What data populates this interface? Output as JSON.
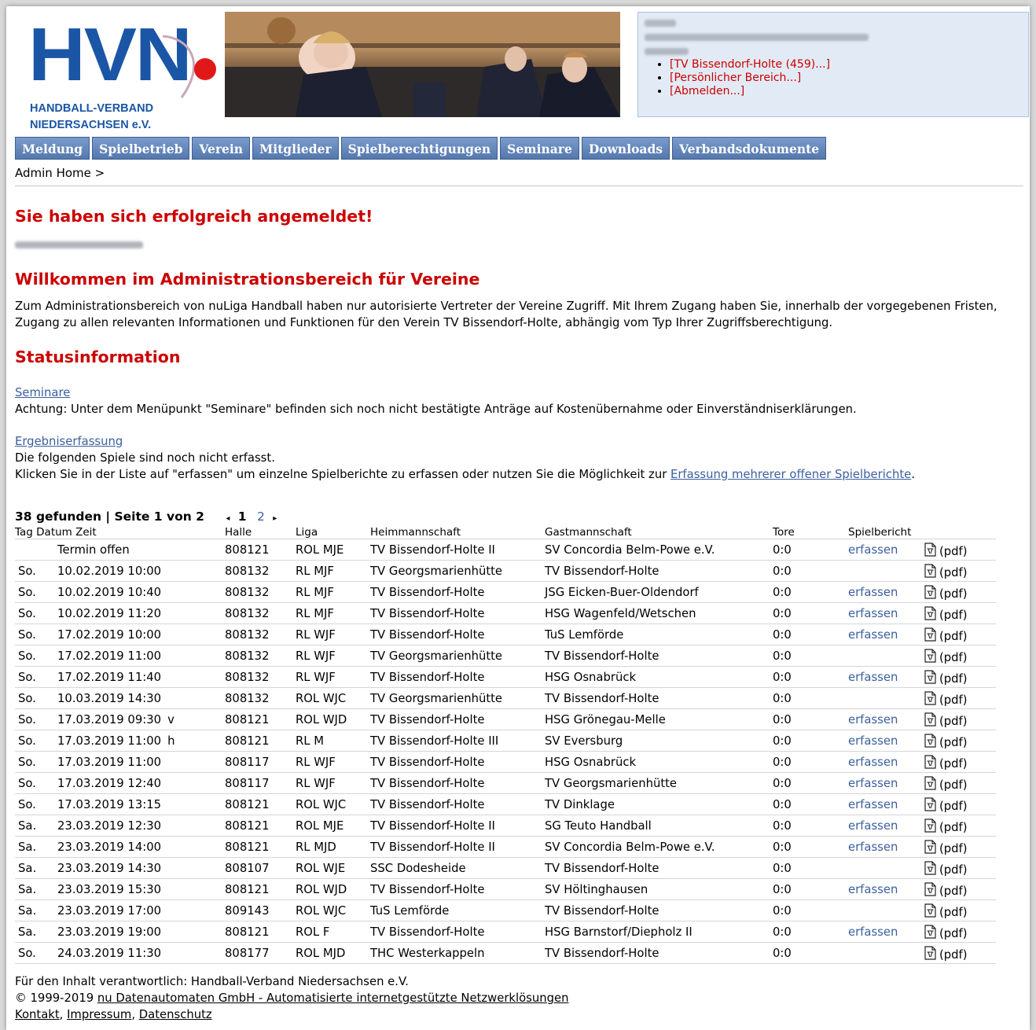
{
  "logo": {
    "letters": "HVN",
    "line1": "HANDBALL-VERBAND",
    "line2": "NIEDERSACHSEN e.V."
  },
  "userbox": {
    "links": [
      "[TV Bissendorf-Holte (459)...]",
      "[Persönlicher Bereich...]",
      "[Abmelden...]"
    ]
  },
  "nav": [
    "Meldung",
    "Spielbetrieb",
    "Verein",
    "Mitglieder",
    "Spielberechtigungen",
    "Seminare",
    "Downloads",
    "Verbandsdokumente"
  ],
  "breadcrumb": "Admin Home >",
  "login_title": "Sie haben sich erfolgreich angemeldet!",
  "welcome_title": "Willkommen im Administrationsbereich für Vereine",
  "intro_text": "Zum Administrationsbereich von nuLiga Handball haben nur autorisierte Vertreter der Vereine Zugriff. Mit Ihrem Zugang haben Sie, innerhalb der vorgegebenen Fristen, Zugang zu allen relevanten Informationen und Funktionen für den Verein TV Bissendorf-Holte, abhängig vom Typ Ihrer Zugriffsberechtigung.",
  "status_title": "Statusinformation",
  "seminare": {
    "link": "Seminare",
    "text": "Achtung: Unter dem Menüpunkt \"Seminare\" befinden sich noch nicht bestätigte Anträge auf Kostenübernahme oder Einverständniserklärungen."
  },
  "ergebnis": {
    "link": "Ergebniserfassung",
    "line1": "Die folgenden Spiele sind noch nicht erfasst.",
    "line2_pre": "Klicken Sie in der Liste auf \"erfassen\" um einzelne Spielberichte zu erfassen oder nutzen Sie die Möglichkeit zur ",
    "line2_link": "Erfassung mehrerer offener Spielberichte",
    "line2_post": "."
  },
  "pager": {
    "summary": "38 gefunden | Seite 1 von 2",
    "prev": "◂",
    "current": "1",
    "next_page": "2",
    "next": "▸"
  },
  "table": {
    "headers": {
      "tag_datum_zeit": "Tag Datum Zeit",
      "halle": "Halle",
      "liga": "Liga",
      "heim": "Heimmannschaft",
      "gast": "Gastmannschaft",
      "tore": "Tore",
      "bericht": "Spielbericht"
    },
    "erfassen_label": "erfassen",
    "pdf_label": "(pdf)",
    "rows": [
      {
        "tag": "",
        "datum": "Termin offen",
        "flag": "",
        "halle": "808121",
        "liga": "ROL MJE",
        "heim": "TV Bissendorf-Holte II",
        "gast": "SV Concordia Belm-Powe e.V.",
        "tore": "0:0",
        "erfassen": true
      },
      {
        "tag": "So.",
        "datum": "10.02.2019 10:00",
        "flag": "",
        "halle": "808132",
        "liga": "RL MJF",
        "heim": "TV Georgsmarienhütte",
        "gast": "TV Bissendorf-Holte",
        "tore": "0:0",
        "erfassen": false
      },
      {
        "tag": "So.",
        "datum": "10.02.2019 10:40",
        "flag": "",
        "halle": "808132",
        "liga": "RL MJF",
        "heim": "TV Bissendorf-Holte",
        "gast": "JSG Eicken-Buer-Oldendorf",
        "tore": "0:0",
        "erfassen": true
      },
      {
        "tag": "So.",
        "datum": "10.02.2019 11:20",
        "flag": "",
        "halle": "808132",
        "liga": "RL MJF",
        "heim": "TV Bissendorf-Holte",
        "gast": "HSG Wagenfeld/Wetschen",
        "tore": "0:0",
        "erfassen": true
      },
      {
        "tag": "So.",
        "datum": "17.02.2019 10:00",
        "flag": "",
        "halle": "808132",
        "liga": "RL WJF",
        "heim": "TV Bissendorf-Holte",
        "gast": "TuS Lemförde",
        "tore": "0:0",
        "erfassen": true
      },
      {
        "tag": "So.",
        "datum": "17.02.2019 11:00",
        "flag": "",
        "halle": "808132",
        "liga": "RL WJF",
        "heim": "TV Georgsmarienhütte",
        "gast": "TV Bissendorf-Holte",
        "tore": "0:0",
        "erfassen": false
      },
      {
        "tag": "So.",
        "datum": "17.02.2019 11:40",
        "flag": "",
        "halle": "808132",
        "liga": "RL WJF",
        "heim": "TV Bissendorf-Holte",
        "gast": "HSG Osnabrück",
        "tore": "0:0",
        "erfassen": true
      },
      {
        "tag": "So.",
        "datum": "10.03.2019 14:30",
        "flag": "",
        "halle": "808132",
        "liga": "ROL WJC",
        "heim": "TV Georgsmarienhütte",
        "gast": "TV Bissendorf-Holte",
        "tore": "0:0",
        "erfassen": false
      },
      {
        "tag": "So.",
        "datum": "17.03.2019 09:30",
        "flag": "v",
        "halle": "808121",
        "liga": "ROL WJD",
        "heim": "TV Bissendorf-Holte",
        "gast": "HSG Grönegau-Melle",
        "tore": "0:0",
        "erfassen": true
      },
      {
        "tag": "So.",
        "datum": "17.03.2019 11:00",
        "flag": "h",
        "halle": "808121",
        "liga": "RL M",
        "heim": "TV Bissendorf-Holte III",
        "gast": "SV Eversburg",
        "tore": "0:0",
        "erfassen": true
      },
      {
        "tag": "So.",
        "datum": "17.03.2019 11:00",
        "flag": "",
        "halle": "808117",
        "liga": "RL WJF",
        "heim": "TV Bissendorf-Holte",
        "gast": "HSG Osnabrück",
        "tore": "0:0",
        "erfassen": true
      },
      {
        "tag": "So.",
        "datum": "17.03.2019 12:40",
        "flag": "",
        "halle": "808117",
        "liga": "RL WJF",
        "heim": "TV Bissendorf-Holte",
        "gast": "TV Georgsmarienhütte",
        "tore": "0:0",
        "erfassen": true
      },
      {
        "tag": "So.",
        "datum": "17.03.2019 13:15",
        "flag": "",
        "halle": "808121",
        "liga": "ROL WJC",
        "heim": "TV Bissendorf-Holte",
        "gast": "TV Dinklage",
        "tore": "0:0",
        "erfassen": true
      },
      {
        "tag": "Sa.",
        "datum": "23.03.2019 12:30",
        "flag": "",
        "halle": "808121",
        "liga": "ROL MJE",
        "heim": "TV Bissendorf-Holte II",
        "gast": "SG Teuto Handball",
        "tore": "0:0",
        "erfassen": true
      },
      {
        "tag": "Sa.",
        "datum": "23.03.2019 14:00",
        "flag": "",
        "halle": "808121",
        "liga": "RL MJD",
        "heim": "TV Bissendorf-Holte II",
        "gast": "SV Concordia Belm-Powe e.V.",
        "tore": "0:0",
        "erfassen": true
      },
      {
        "tag": "Sa.",
        "datum": "23.03.2019 14:30",
        "flag": "",
        "halle": "808107",
        "liga": "ROL WJE",
        "heim": "SSC Dodesheide",
        "gast": "TV Bissendorf-Holte",
        "tore": "0:0",
        "erfassen": false
      },
      {
        "tag": "Sa.",
        "datum": "23.03.2019 15:30",
        "flag": "",
        "halle": "808121",
        "liga": "ROL WJD",
        "heim": "TV Bissendorf-Holte",
        "gast": "SV Höltinghausen",
        "tore": "0:0",
        "erfassen": true
      },
      {
        "tag": "Sa.",
        "datum": "23.03.2019 17:00",
        "flag": "",
        "halle": "809143",
        "liga": "ROL WJC",
        "heim": "TuS Lemförde",
        "gast": "TV Bissendorf-Holte",
        "tore": "0:0",
        "erfassen": false
      },
      {
        "tag": "Sa.",
        "datum": "23.03.2019 19:00",
        "flag": "",
        "halle": "808121",
        "liga": "ROL F",
        "heim": "TV Bissendorf-Holte",
        "gast": "HSG Barnstorf/Diepholz II",
        "tore": "0:0",
        "erfassen": true
      },
      {
        "tag": "So.",
        "datum": "24.03.2019 11:30",
        "flag": "",
        "halle": "808177",
        "liga": "ROL MJD",
        "heim": "THC Westerkappeln",
        "gast": "TV Bissendorf-Holte",
        "tore": "0:0",
        "erfassen": false
      }
    ]
  },
  "footer": {
    "line1": "Für den Inhalt verantwortlich: Handball-Verband Niedersachsen e.V.",
    "copyright": "© 1999-2019 ",
    "nu_link": "nu Datenautomaten GmbH - Automatisierte internetgestützte Netzwerklösungen",
    "kontakt": "Kontakt",
    "impressum": "Impressum",
    "datenschutz": "Datenschutz"
  },
  "colors": {
    "brand_blue": "#1b56a6",
    "heading_red": "#cc0000",
    "nav_blue": "#5a7db3",
    "link_blue": "#3b5f9e"
  }
}
